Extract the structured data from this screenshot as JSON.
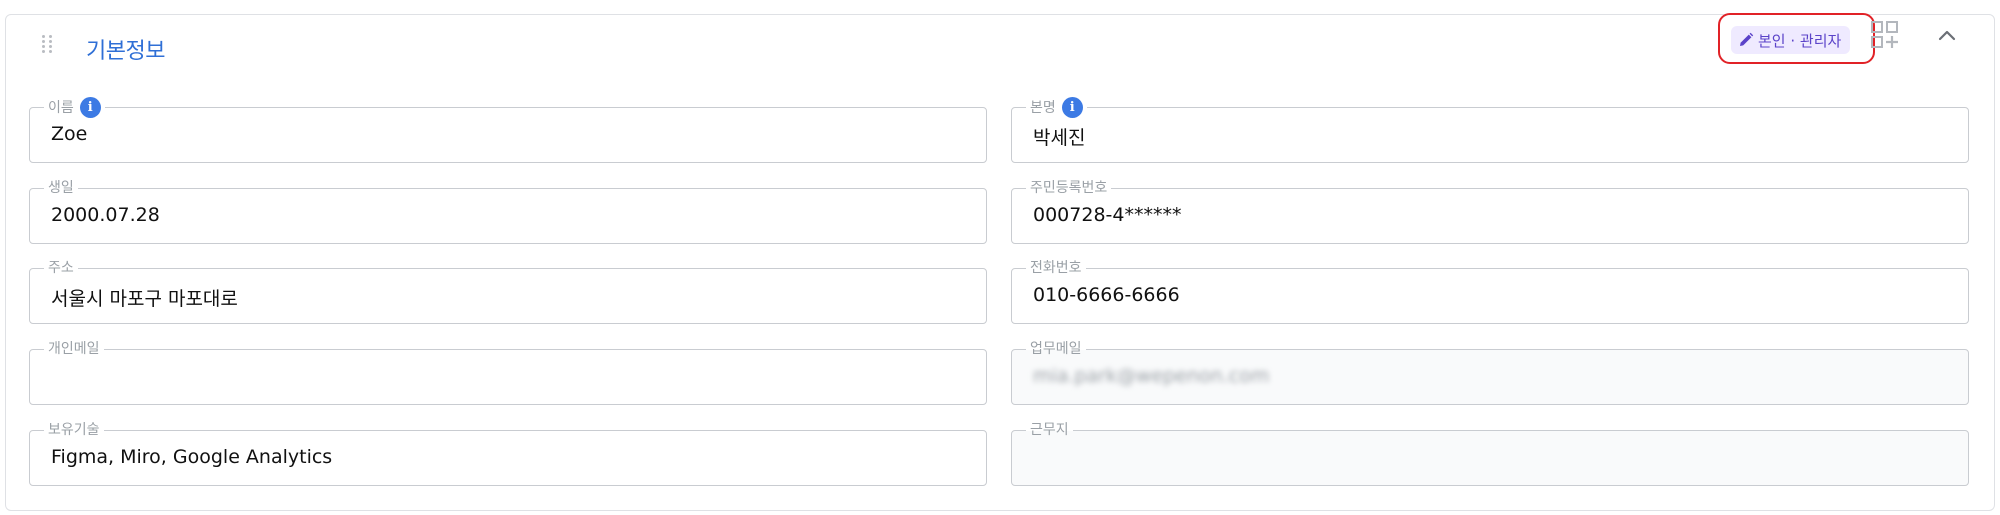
{
  "section": {
    "title": "기본정보",
    "permission_badge": "본인 · 관리자"
  },
  "fields": {
    "name": {
      "label": "이름",
      "value": "Zoe"
    },
    "real_name": {
      "label": "본명",
      "value": "박세진"
    },
    "birthday": {
      "label": "생일",
      "value": "2000.07.28"
    },
    "resident_number": {
      "label": "주민등록번호",
      "value": "000728-4******"
    },
    "address": {
      "label": "주소",
      "value": "서울시 마포구 마포대로"
    },
    "phone": {
      "label": "전화번호",
      "value": "010-6666-6666"
    },
    "personal_email": {
      "label": "개인메일",
      "value": ""
    },
    "work_email": {
      "label": "업무메일",
      "value": "mia.park@wepenon.com"
    },
    "skills": {
      "label": "보유기술",
      "value": "Figma, Miro, Google Analytics"
    },
    "workplace": {
      "label": "근무지",
      "value": ""
    }
  },
  "colors": {
    "title": "#2f6fd6",
    "badge_bg": "#efeaff",
    "badge_text": "#5b43c9",
    "highlight": "#e12227",
    "info_icon": "#3c7ae4"
  },
  "icons": {
    "drag": "drag-handle-icon",
    "edit": "pencil-icon",
    "add_widget": "grid-add-icon",
    "collapse": "chevron-up-icon",
    "info": "info-icon"
  }
}
